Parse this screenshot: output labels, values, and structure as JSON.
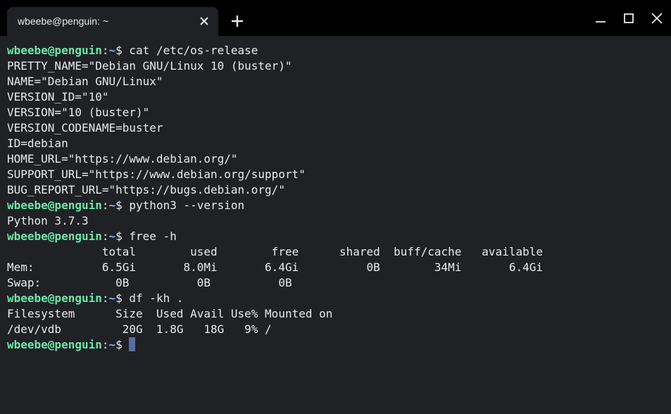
{
  "window": {
    "tab_title": "wbeebe@penguin: ~"
  },
  "icons": {
    "tab_close": "close-icon",
    "new_tab": "plus-icon",
    "minimize": "minimize-icon",
    "maximize": "maximize-icon",
    "close": "close-icon"
  },
  "colors": {
    "background": "#202124",
    "titlebar": "#000000",
    "text": "#e8eaed",
    "prompt_user": "#6ee7a8",
    "prompt_path": "#8ab4f8",
    "cursor": "#56709f"
  },
  "prompt": {
    "user_host": "wbeebe@penguin",
    "separator": ":",
    "path": "~",
    "symbol": "$ "
  },
  "terminal": {
    "lines": [
      {
        "type": "cmd",
        "text": "cat /etc/os-release"
      },
      {
        "type": "out",
        "text": "PRETTY_NAME=\"Debian GNU/Linux 10 (buster)\""
      },
      {
        "type": "out",
        "text": "NAME=\"Debian GNU/Linux\""
      },
      {
        "type": "out",
        "text": "VERSION_ID=\"10\""
      },
      {
        "type": "out",
        "text": "VERSION=\"10 (buster)\""
      },
      {
        "type": "out",
        "text": "VERSION_CODENAME=buster"
      },
      {
        "type": "out",
        "text": "ID=debian"
      },
      {
        "type": "out",
        "text": "HOME_URL=\"https://www.debian.org/\""
      },
      {
        "type": "out",
        "text": "SUPPORT_URL=\"https://www.debian.org/support\""
      },
      {
        "type": "out",
        "text": "BUG_REPORT_URL=\"https://bugs.debian.org/\""
      },
      {
        "type": "cmd",
        "text": "python3 --version"
      },
      {
        "type": "out",
        "text": "Python 3.7.3"
      },
      {
        "type": "cmd",
        "text": "free -h"
      },
      {
        "type": "out",
        "text": "              total        used        free      shared  buff/cache   available"
      },
      {
        "type": "out",
        "text": "Mem:          6.5Gi       8.0Mi       6.4Gi          0B        34Mi       6.4Gi"
      },
      {
        "type": "out",
        "text": "Swap:           0B          0B          0B"
      },
      {
        "type": "cmd",
        "text": "df -kh ."
      },
      {
        "type": "out",
        "text": "Filesystem      Size  Used Avail Use% Mounted on"
      },
      {
        "type": "out",
        "text": "/dev/vdb         20G  1.8G   18G   9% /"
      },
      {
        "type": "cmd",
        "text": "",
        "cursor": true
      }
    ]
  }
}
